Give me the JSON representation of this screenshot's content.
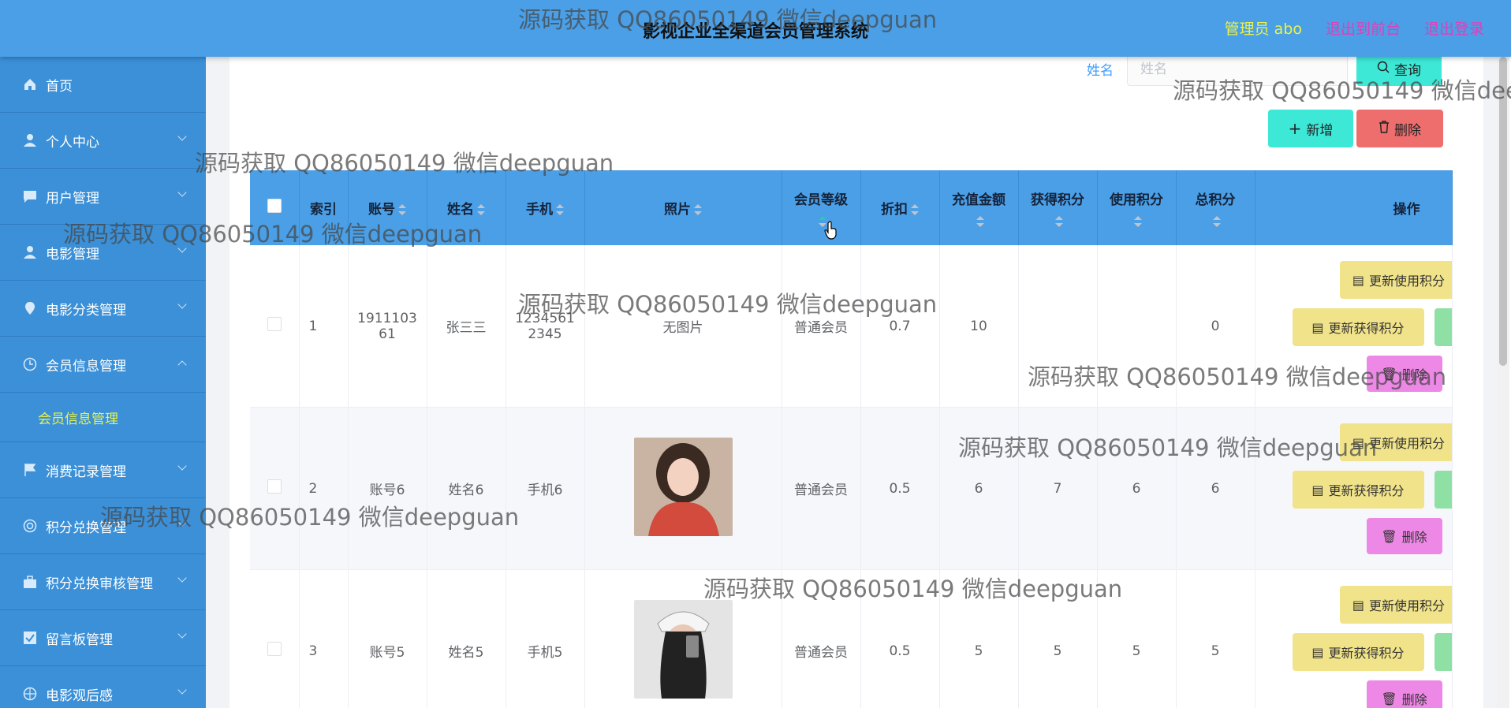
{
  "header": {
    "title": "影视企业全渠道会员管理系统",
    "user": "管理员 abo",
    "front_link": "退出到前台",
    "logout_link": "退出登录"
  },
  "sidebar": {
    "items": [
      {
        "label": "首页",
        "icon": "home-icon"
      },
      {
        "label": "个人中心",
        "icon": "user-icon"
      },
      {
        "label": "用户管理",
        "icon": "chat-icon"
      },
      {
        "label": "电影管理",
        "icon": "user-icon"
      },
      {
        "label": "电影分类管理",
        "icon": "location-icon"
      },
      {
        "label": "会员信息管理",
        "icon": "clock-icon"
      },
      {
        "label": "消费记录管理",
        "icon": "flag-icon"
      },
      {
        "label": "积分兑换管理",
        "icon": "circle-icon"
      },
      {
        "label": "积分兑换审核管理",
        "icon": "briefcase-icon"
      },
      {
        "label": "留言板管理",
        "icon": "check-icon"
      },
      {
        "label": "电影观后感",
        "icon": "target-icon"
      }
    ],
    "sub_active": "会员信息管理"
  },
  "search": {
    "label": "姓名",
    "placeholder": "姓名",
    "query_button": "查询"
  },
  "actions": {
    "add": "新增",
    "delete": "删除"
  },
  "table": {
    "columns": [
      "索引",
      "账号",
      "姓名",
      "手机",
      "照片",
      "会员等级",
      "折扣",
      "充值金额",
      "获得积分",
      "使用积分",
      "总积分",
      "操作"
    ],
    "rows": [
      {
        "index": "1",
        "account": "191110361",
        "account_display": [
          "1911103",
          "61"
        ],
        "name": "张三三",
        "phone": "12345612345",
        "phone_display": [
          "1234561",
          "2345"
        ],
        "photo": "无图片",
        "level": "普通会员",
        "discount": "0.7",
        "recharge": "10",
        "earned": "",
        "used": "",
        "total": "0"
      },
      {
        "index": "2",
        "account": "账号6",
        "name": "姓名6",
        "phone": "手机6",
        "photo": "",
        "level": "普通会员",
        "discount": "0.5",
        "recharge": "6",
        "earned": "7",
        "used": "6",
        "total": "6"
      },
      {
        "index": "3",
        "account": "账号5",
        "name": "姓名5",
        "phone": "手机5",
        "photo": "",
        "level": "普通会员",
        "discount": "0.5",
        "recharge": "5",
        "earned": "5",
        "used": "5",
        "total": "5"
      }
    ],
    "op_labels": {
      "update_used": "更新使用积分",
      "update_earned": "更新获得积分",
      "delete": "删除"
    }
  },
  "watermark": "源码获取 QQ86050149 微信deepguan"
}
